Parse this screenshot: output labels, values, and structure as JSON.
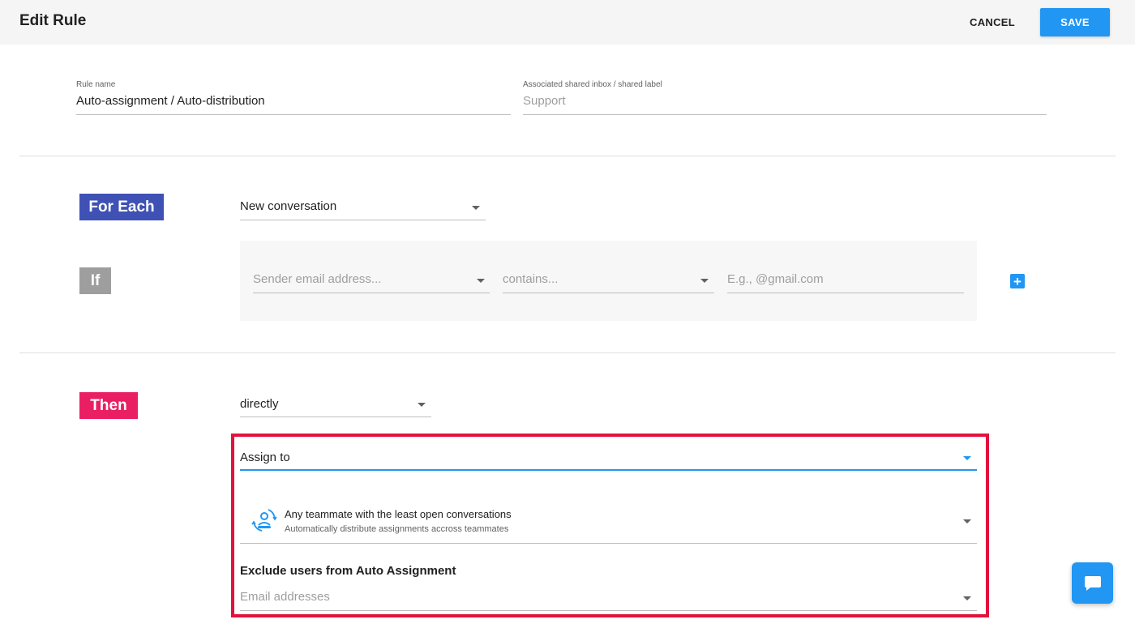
{
  "header": {
    "title": "Edit Rule",
    "cancel_label": "CANCEL",
    "save_label": "SAVE"
  },
  "rule_name": {
    "label": "Rule name",
    "value": "Auto-assignment / Auto-distribution"
  },
  "shared_inbox": {
    "label": "Associated shared inbox / shared label",
    "placeholder": "Support"
  },
  "for_each": {
    "badge": "For Each",
    "badge_color": "#3f51b5",
    "selected": "New conversation"
  },
  "if_section": {
    "badge": "If",
    "badge_color": "#9e9e9e",
    "field_placeholder": "Sender email address...",
    "operator_placeholder": "contains...",
    "value_placeholder": "E.g., @gmail.com",
    "add_icon": "plus-icon"
  },
  "then_section": {
    "badge": "Then",
    "badge_color": "#e91e63",
    "mode": "directly",
    "action": "Assign to",
    "assignee_title": "Any teammate with the least open conversations",
    "assignee_subtitle": "Automatically distribute assignments accross teammates",
    "assignee_icon": "round-robin-distribution-icon",
    "exclude_heading": "Exclude users from Auto Assignment",
    "exclude_placeholder": "Email addresses",
    "highlight_color": "#e2123e"
  },
  "chat_widget": {
    "icon": "chat-bubble-icon",
    "color": "#2196f3"
  }
}
